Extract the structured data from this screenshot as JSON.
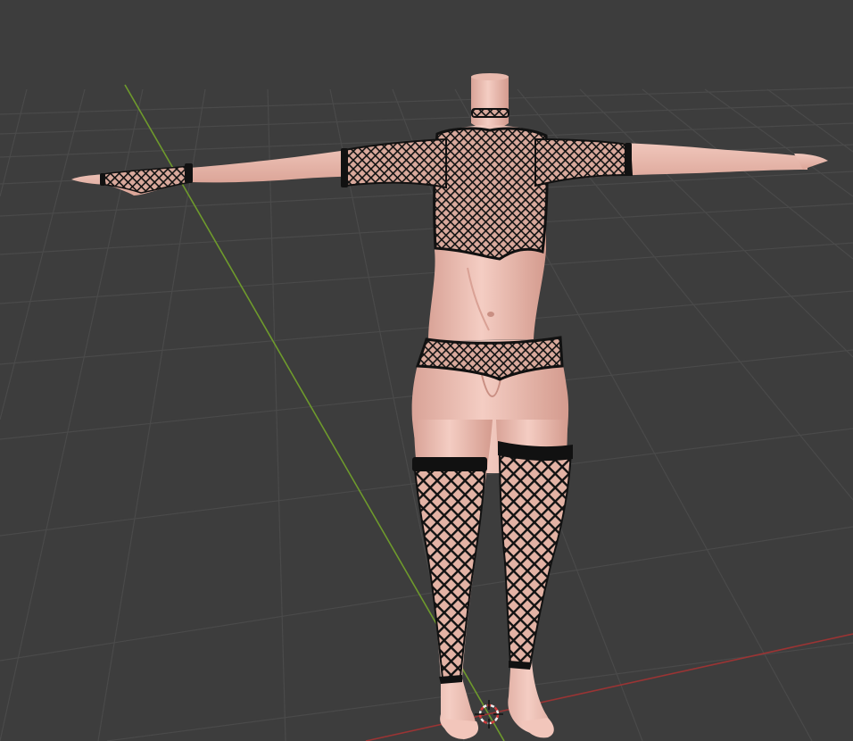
{
  "viewport": {
    "background": "#3d3d3d",
    "grid_color": "#4a4a4a",
    "y_axis_color": "#6e9a2c",
    "x_axis_color": "#9a3434"
  },
  "model": {
    "skin_color": "#f0c2b6",
    "fabric_color": "#121212",
    "mesh_color": "#d6a79a"
  },
  "cursor": {
    "icon": "3d-cursor-icon",
    "ring_color": "#d23b3b",
    "ring_alt_color": "#f0f0f0"
  }
}
